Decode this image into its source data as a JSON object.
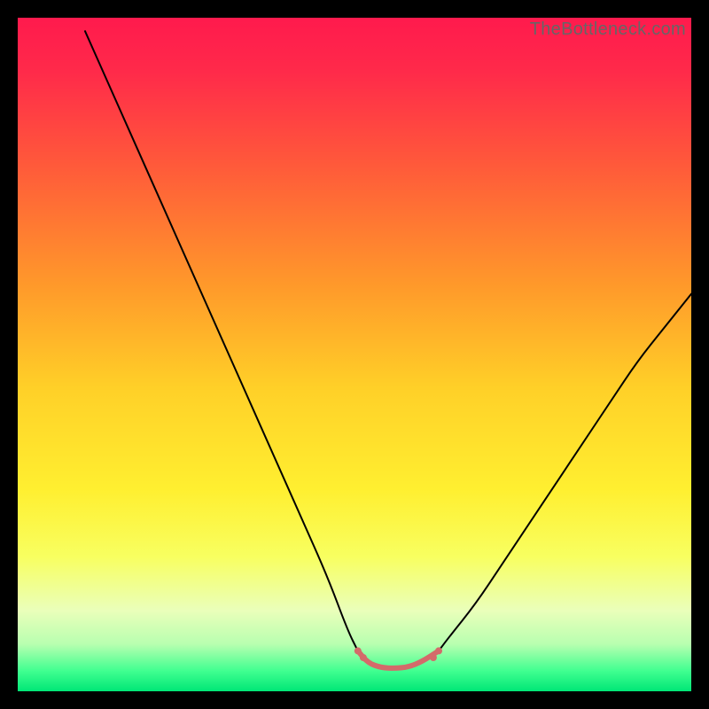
{
  "watermark": "TheBottleneck.com",
  "chart_data": {
    "type": "line",
    "title": "",
    "xlabel": "",
    "ylabel": "",
    "xlim": [
      0,
      100
    ],
    "ylim": [
      0,
      100
    ],
    "gradient_stops": [
      {
        "offset": 0.0,
        "color": "#ff1a4d"
      },
      {
        "offset": 0.08,
        "color": "#ff2a4a"
      },
      {
        "offset": 0.22,
        "color": "#ff5a3a"
      },
      {
        "offset": 0.4,
        "color": "#ff9a2a"
      },
      {
        "offset": 0.55,
        "color": "#ffd028"
      },
      {
        "offset": 0.7,
        "color": "#ffef30"
      },
      {
        "offset": 0.8,
        "color": "#f8ff60"
      },
      {
        "offset": 0.88,
        "color": "#eaffba"
      },
      {
        "offset": 0.93,
        "color": "#b8ffb0"
      },
      {
        "offset": 0.97,
        "color": "#40ff90"
      },
      {
        "offset": 1.0,
        "color": "#00e676"
      }
    ],
    "series": [
      {
        "name": "left-curve",
        "color": "#000000",
        "width": 2,
        "x": [
          10,
          14,
          18,
          22,
          26,
          30,
          34,
          38,
          42,
          46,
          49,
          50.5
        ],
        "y": [
          98,
          89,
          80,
          71,
          62,
          53,
          44,
          35,
          26,
          17,
          9,
          6
        ]
      },
      {
        "name": "right-curve",
        "color": "#000000",
        "width": 2,
        "x": [
          62.5,
          64,
          68,
          72,
          76,
          80,
          84,
          88,
          92,
          96,
          100
        ],
        "y": [
          6,
          8,
          13,
          19,
          25,
          31,
          37,
          43,
          49,
          54,
          59
        ]
      },
      {
        "name": "valley-overlay",
        "color": "#d46a6a",
        "width": 6,
        "x": [
          50.5,
          52,
          54,
          56,
          58,
          60,
          62.5
        ],
        "y": [
          6,
          4.2,
          3.5,
          3.4,
          3.6,
          4.4,
          6
        ]
      }
    ],
    "markers": [
      {
        "series": "valley-overlay",
        "x": 50.5,
        "y": 6.0,
        "r": 4,
        "color": "#d46a6a"
      },
      {
        "series": "valley-overlay",
        "x": 51.3,
        "y": 5.0,
        "r": 4,
        "color": "#d46a6a"
      },
      {
        "series": "valley-overlay",
        "x": 61.7,
        "y": 5.0,
        "r": 4,
        "color": "#d46a6a"
      },
      {
        "series": "valley-overlay",
        "x": 62.5,
        "y": 6.0,
        "r": 4,
        "color": "#d46a6a"
      }
    ]
  }
}
